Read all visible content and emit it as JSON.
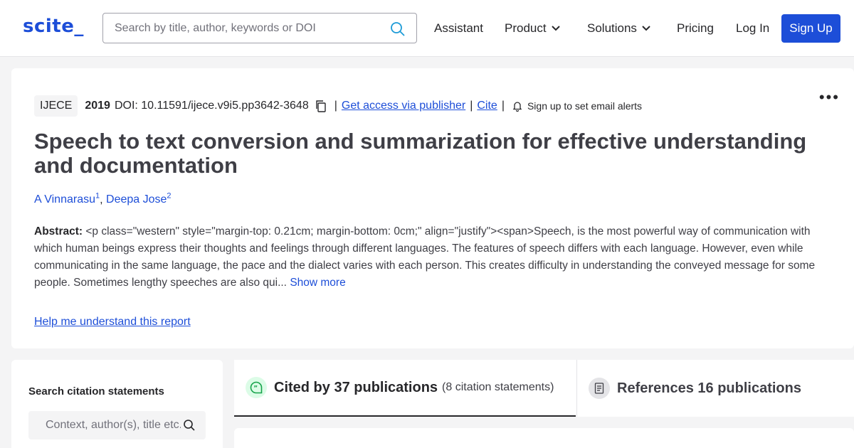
{
  "header": {
    "logo": "scite_",
    "search_placeholder": "Search by title, author, keywords or DOI",
    "nav": {
      "assistant": "Assistant",
      "product": "Product",
      "solutions": "Solutions",
      "pricing": "Pricing",
      "login": "Log In",
      "signup": "Sign Up"
    },
    "accent_color": "#1d4ed8"
  },
  "paper": {
    "journal": "IJECE",
    "year": "2019",
    "doi": "DOI: 10.11591/ijece.v9i5.pp3642-3648",
    "get_access": "Get access via publisher",
    "cite": "Cite",
    "alerts": "Sign up to set email alerts",
    "title": "Speech to text conversion and summarization for effective understanding and documentation",
    "authors": [
      {
        "name": "A Vinnarasu",
        "sup": "1"
      },
      {
        "name": "Deepa Jose",
        "sup": "2"
      }
    ],
    "abstract_label": "Abstract:",
    "abstract_text": "<p class=\"western\" style=\"margin-top: 0.21cm; margin-bottom: 0cm;\" align=\"justify\"><span>Speech, is the most powerful way of communication with which human beings express their thoughts and feelings through different languages. The features of speech differs with each language. However, even while communicating in the same language, the pace and the dialect varies with each person. This creates difficulty in understanding the conveyed message for some people. Sometimes lengthy speeches are also qui...",
    "show_more": "Show more",
    "help_link": "Help me understand this report"
  },
  "sidebar": {
    "title": "Search citation statements",
    "input_placeholder": "Context, author(s), title etc."
  },
  "tabs": {
    "cited_main": "Cited by 37 publications",
    "cited_sub": "(8 citation statements)",
    "refs_main": "References 16 publications"
  }
}
